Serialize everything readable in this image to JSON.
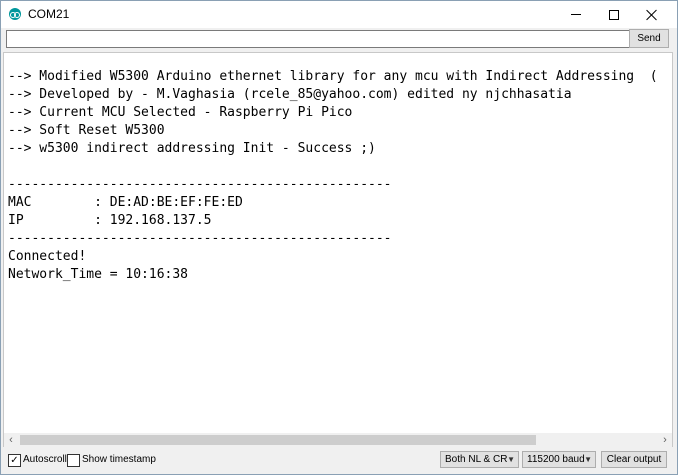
{
  "window": {
    "title": "COM21"
  },
  "input": {
    "value": "",
    "placeholder": "",
    "send_label": "Send"
  },
  "output": {
    "lines": [
      "--> Modified W5300 Arduino ethernet library for any mcu with Indirect Addressing  (",
      "--> Developed by - M.Vaghasia (rcele_85@yahoo.com) edited ny njchhasatia",
      "--> Current MCU Selected - Raspberry Pi Pico",
      "--> Soft Reset W5300",
      "--> w5300 indirect addressing Init - Success ;)",
      "",
      "-------------------------------------------------",
      "MAC        : DE:AD:BE:EF:FE:ED",
      "IP         : 192.168.137.5",
      "-------------------------------------------------",
      "Connected!",
      "Network_Time = 10:16:38"
    ]
  },
  "bottom": {
    "autoscroll_label": "Autoscroll",
    "autoscroll_checked": true,
    "timestamp_label": "Show timestamp",
    "timestamp_checked": false,
    "line_ending": "Both NL & CR",
    "baud": "115200 baud",
    "clear_label": "Clear output"
  },
  "icons": {
    "check": "✓",
    "arrow_left": "‹",
    "arrow_right": "›",
    "dropdown": "▼"
  }
}
